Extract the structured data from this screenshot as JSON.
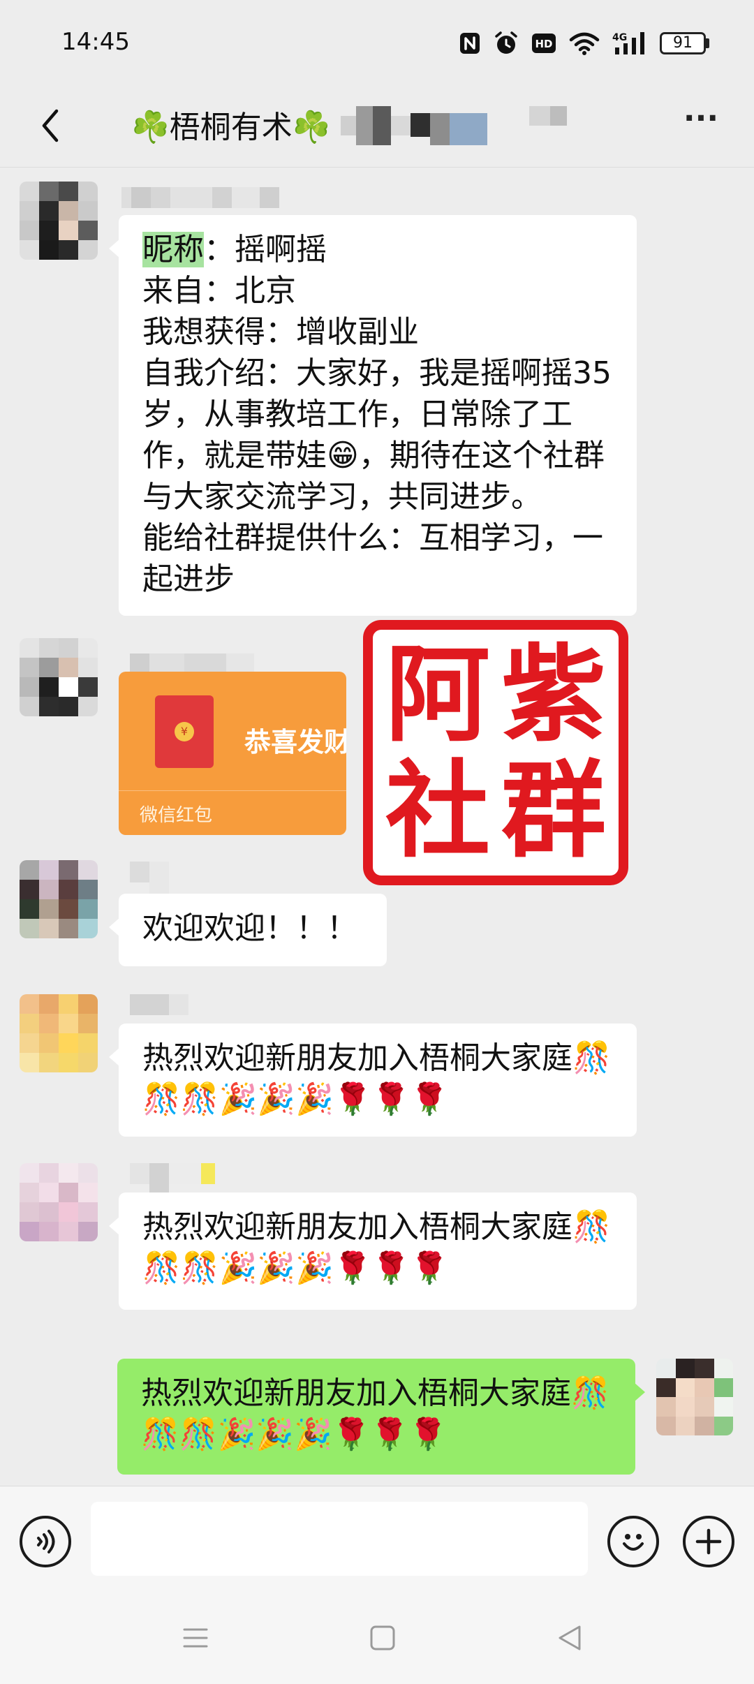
{
  "status_bar": {
    "time": "14:45",
    "icons": [
      "nfc-icon",
      "alarm-icon",
      "hd-icon",
      "wifi-icon",
      "4g-signal-icon"
    ],
    "hd": "HD",
    "network": "4G",
    "battery": "91"
  },
  "header": {
    "title": "☘️梧桐有术☘️",
    "more": "···"
  },
  "messages": {
    "intro": {
      "lines": [
        "昵称：摇啊摇",
        "来自：北京",
        "我想获得：增收副业",
        "自我介绍：大家好，我是摇啊摇35",
        "岁，从事教培工作，日常除了工",
        "作，就是带娃😁，期待在这个社群",
        "与大家交流学习，共同进步。",
        "能给社群提供什么：互相学习，一",
        "起进步"
      ],
      "highlight": "昵称"
    },
    "red_packet": {
      "title": "恭喜发财",
      "label": "微信红包",
      "coin": "¥"
    },
    "welcome": "欢迎欢迎！！！",
    "greeting_1": {
      "line1": "热烈欢迎新朋友加入梧桐大家庭🎊",
      "line2": "🎊🎊🎉🎉🎉🌹🌹🌹"
    },
    "greeting_2": {
      "line1": "热烈欢迎新朋友加入梧桐大家庭🎊",
      "line2": "🎊🎊🎉🎉🎉🌹🌹🌹"
    },
    "greeting_mine": {
      "line1": "热烈欢迎新朋友加入梧桐大家庭🎊",
      "line2": "🎊🎊🎉🎉🎉🌹🌹🌹"
    }
  },
  "watermark": {
    "chars": [
      "阿",
      "紫",
      "社",
      "群"
    ]
  },
  "input_bar": {
    "placeholder": ""
  },
  "colors": {
    "background": "#ededed",
    "bubble_in": "#ffffff",
    "bubble_out": "#95ec69",
    "red_packet": "#f79c3c",
    "stamp_red": "#e0191f"
  }
}
